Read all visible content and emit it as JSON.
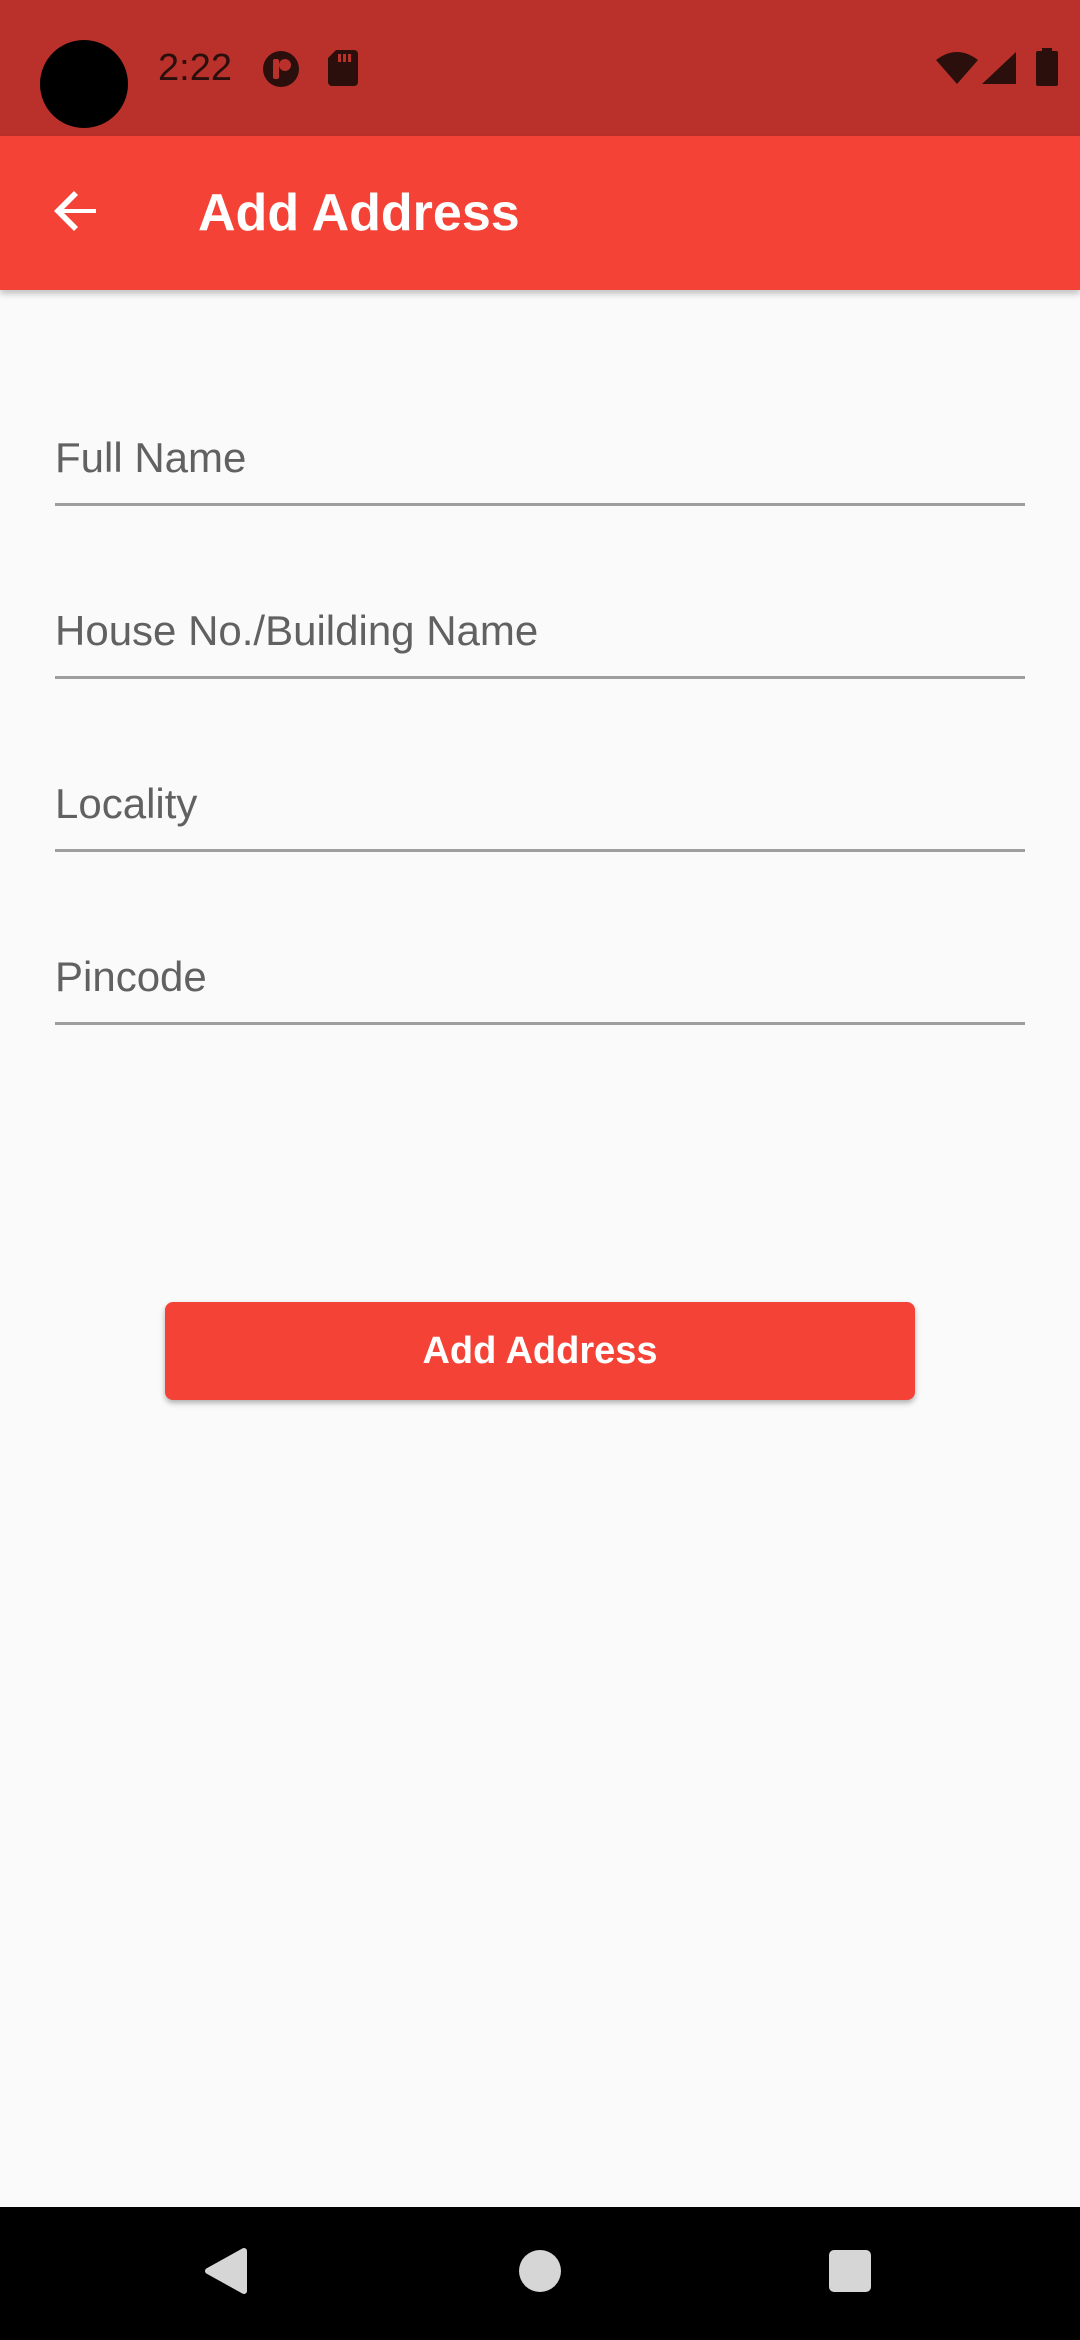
{
  "status_bar": {
    "time": "2:22",
    "icons": [
      "camera-cutout",
      "notification-app-icon",
      "sd-card-icon",
      "wifi-icon",
      "cellular-signal-icon",
      "battery-icon"
    ]
  },
  "app_bar": {
    "back_icon": "arrow-left-icon",
    "title": "Add Address"
  },
  "form": {
    "fields": [
      {
        "placeholder": "Full Name",
        "value": ""
      },
      {
        "placeholder": "House No./Building Name",
        "value": ""
      },
      {
        "placeholder": "Locality",
        "value": ""
      },
      {
        "placeholder": "Pincode",
        "value": ""
      }
    ],
    "submit_label": "Add Address"
  },
  "nav_bar": {
    "icons": [
      "back-triangle-icon",
      "home-circle-icon",
      "recents-square-icon"
    ]
  },
  "colors": {
    "status_bar": "#b9312a",
    "app_bar": "#f44336",
    "button": "#f44336",
    "background": "#fafafa"
  }
}
